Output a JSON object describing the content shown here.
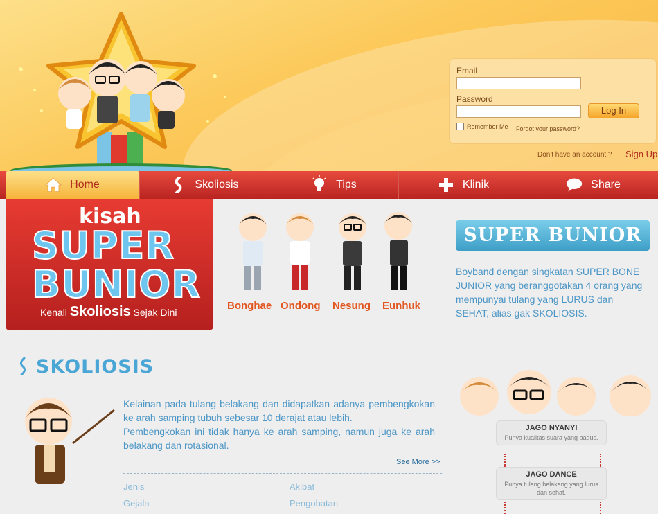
{
  "login": {
    "email_label": "Email",
    "email_value": "",
    "password_label": "Password",
    "password_value": "",
    "login_button": "Log In",
    "remember_label": "Remember Me",
    "forgot_link": "Forgot your password?",
    "no_account_text": "Don't have an account ?",
    "signup_link": "Sign Up"
  },
  "nav": {
    "items": [
      {
        "label": "Home",
        "icon": "home-icon"
      },
      {
        "label": "Skoliosis",
        "icon": "spine-icon"
      },
      {
        "label": "Tips",
        "icon": "lightbulb-icon"
      },
      {
        "label": "Klinik",
        "icon": "cross-icon"
      },
      {
        "label": "Share",
        "icon": "chat-bubble-icon"
      }
    ]
  },
  "hero": {
    "kisah": "kisah",
    "title_line1": "SUPER",
    "title_line2": "BUNIOR",
    "tagline_part1": "Kenali",
    "tagline_big": "Skoliosis",
    "tagline_part2": "Sejak Dini"
  },
  "characters": [
    "Bonghae",
    "Ondong",
    "Nesung",
    "Eunhuk"
  ],
  "superbunior": {
    "banner": "SUPER BUNIOR",
    "description": "Boyband dengan singkatan SUPER BONE JUNIOR yang beranggotakan 4 orang yang mempunyai tulang yang LURUS dan SEHAT, alias gak SKOLIOSIS."
  },
  "skoliosis": {
    "title": "SKOLIOSIS",
    "paragraph1": "Kelainan pada tulang belakang dan didapatkan adanya pembengkokan ke arah samping tubuh sebesar 10 derajat atau lebih.",
    "paragraph2": "Pembengkokan ini tidak hanya ke arah samping, namun juga ke arah belakang dan rotasional.",
    "see_more": "See More >>",
    "links": [
      "Jenis",
      "Akibat",
      "Gejala",
      "Pengobatan"
    ]
  },
  "skills": [
    {
      "title": "JAGO NYANYI",
      "desc": "Punya kualitas suara yang bagus."
    },
    {
      "title": "JAGO DANCE",
      "desc": "Punya tulang belakang yang lurus dan sehat."
    }
  ],
  "colors": {
    "nav_red": "#c9302a",
    "header_yellow": "#fcc95a",
    "text_blue": "#4b96c6",
    "accent_orange": "#e2561f"
  }
}
